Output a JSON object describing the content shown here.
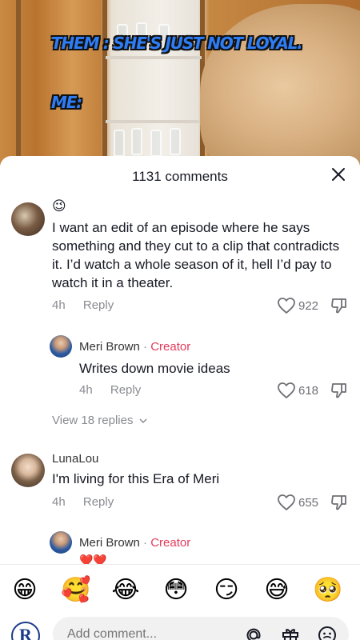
{
  "video": {
    "caption_line1": "THEM : SHE'S JUST NOT LOYAL.",
    "caption_line2": "ME:"
  },
  "sheet": {
    "title": "1131 comments"
  },
  "comments": [
    {
      "emoji": "😉",
      "text": "I want an edit of an episode where he says something and they cut to a clip that contradicts it. I’d watch a whole season of it, hell I’d pay to watch it in a theater.",
      "time": "4h",
      "reply_label": "Reply",
      "likes": "922"
    },
    {
      "author": "Meri Brown",
      "badge": "Creator",
      "text": "Writes down movie ideas",
      "time": "4h",
      "reply_label": "Reply",
      "likes": "618"
    },
    {
      "view_replies": "View 18 replies"
    },
    {
      "author": "LunaLou",
      "text": "I'm living for this Era of Meri",
      "time": "4h",
      "reply_label": "Reply",
      "likes": "655"
    },
    {
      "author": "Meri Brown",
      "badge": "Creator",
      "text": "❤️❤️"
    }
  ],
  "emoji_bar": [
    "😁",
    "🥰",
    "😂",
    "😳",
    "😏",
    "😅",
    "🥺"
  ],
  "input": {
    "placeholder": "Add comment...",
    "user_avatar": "R"
  },
  "colors": {
    "creator": "#e23b5c",
    "caption": "#2e7df5",
    "muted": "#8a8b91"
  }
}
